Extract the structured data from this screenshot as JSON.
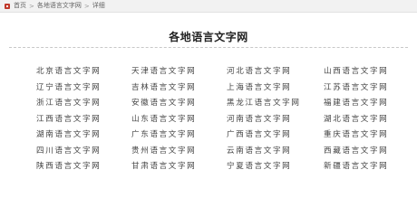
{
  "breadcrumb": {
    "items": [
      "首页",
      "各地语言文字网",
      "详细"
    ],
    "separator": ">"
  },
  "title": "各地语言文字网",
  "columns": [
    [
      "北京语言文字网",
      "辽宁语言文字网",
      "浙江语言文字网",
      "江西语言文字网",
      "湖南语言文字网",
      "四川语言文字网",
      "陕西语言文字网"
    ],
    [
      "天津语言文字网",
      "吉林语言文字网",
      "安徽语言文字网",
      "山东语言文字网",
      "广东语言文字网",
      "贵州语言文字网",
      "甘肃语言文字网"
    ],
    [
      "河北语言文字网",
      "上海语言文字网",
      "黑龙江语言文字网",
      "河南语言文字网",
      "广西语言文字网",
      "云南语言文字网",
      "宁夏语言文字网"
    ],
    [
      "山西语言文字网",
      "江苏语言文字网",
      "福建语言文字网",
      "湖北语言文字网",
      "重庆语言文字网",
      "西藏语言文字网",
      "新疆语言文字网"
    ]
  ],
  "colors": {
    "home_icon": "#c0392b",
    "link_text": "#444444",
    "breadcrumb_bg": "#f2f2f2"
  }
}
